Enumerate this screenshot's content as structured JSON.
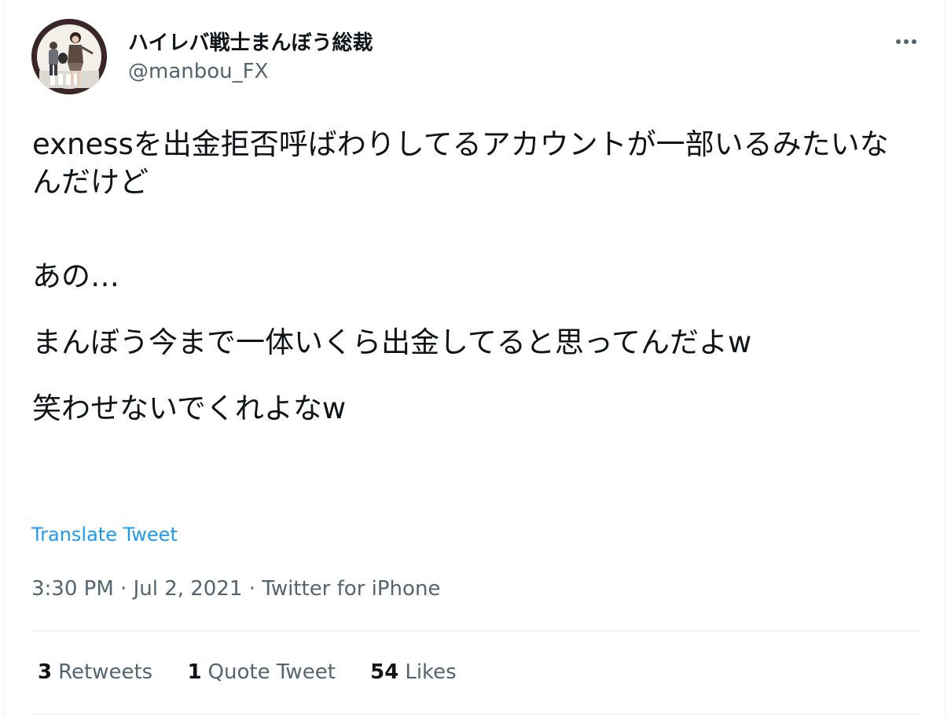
{
  "author": {
    "display_name": "ハイレバ戦士まんぼう総裁",
    "handle": "@manbou_FX"
  },
  "tweet": {
    "paragraphs": [
      "exnessを出金拒否呼ばわりしてるアカウントが一部いるみたいなんだけど",
      "あの…",
      "まんぼう今まで一体いくら出金してると思ってんだよw",
      "笑わせないでくれよなw"
    ],
    "translate_label": "Translate Tweet"
  },
  "meta": {
    "time": "3:30 PM",
    "date": "Jul 2, 2021",
    "source": "Twitter for iPhone",
    "separator": " · "
  },
  "stats": {
    "retweets": {
      "count": "3",
      "label": "Retweets"
    },
    "quote_tweets": {
      "count": "1",
      "label": "Quote Tweet"
    },
    "likes": {
      "count": "54",
      "label": "Likes"
    }
  },
  "icons": {
    "more": "more-horizontal-icon",
    "avatar": "profile-avatar-image"
  },
  "colors": {
    "text": "#0f1419",
    "secondary": "#536471",
    "link": "#1d9bf0",
    "divider": "#e8ecee"
  }
}
